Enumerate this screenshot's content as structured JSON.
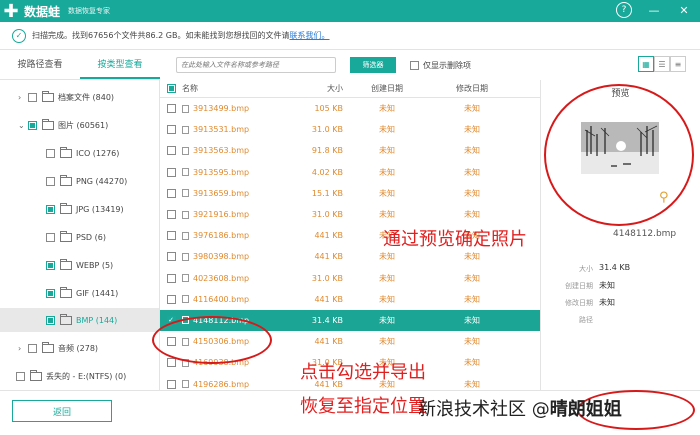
{
  "app": {
    "name": "数据蛙",
    "subtitle": "数据恢复专家",
    "help_icon": "?",
    "minimize": "—",
    "close": "✕",
    "logo_glyph": "✚"
  },
  "status": {
    "text": "扫描完成。找到67656个文件共86.2 GB。如未能找到您想找回的文件请",
    "link": "联系我们。"
  },
  "tabs": [
    "按路径查看",
    "按类型查看"
  ],
  "toolbar": {
    "search_placeholder": "在此处输入文件名称或参考路径",
    "filter_label": "筛选器",
    "deleted_only_label": "仅显示删除项"
  },
  "tree": [
    {
      "label": "档案文件 (840)",
      "caret": "›",
      "level": 0,
      "state": "empty"
    },
    {
      "label": "图片 (60561)",
      "caret": "⌄",
      "level": 0,
      "state": "partial"
    },
    {
      "label": "ICO (1276)",
      "caret": "",
      "level": 1,
      "state": "empty"
    },
    {
      "label": "PNG (44270)",
      "caret": "",
      "level": 1,
      "state": "empty"
    },
    {
      "label": "JPG (13419)",
      "caret": "",
      "level": 1,
      "state": "partial"
    },
    {
      "label": "PSD (6)",
      "caret": "",
      "level": 1,
      "state": "empty"
    },
    {
      "label": "WEBP (5)",
      "caret": "",
      "level": 1,
      "state": "partial"
    },
    {
      "label": "GIF (1441)",
      "caret": "",
      "level": 1,
      "state": "partial"
    },
    {
      "label": "BMP (144)",
      "caret": "",
      "level": 1,
      "state": "partial",
      "selected": true
    },
    {
      "label": "音频 (278)",
      "caret": "›",
      "level": 0,
      "state": "empty"
    },
    {
      "label": "丢失的 - E:(NTFS) (0)",
      "caret": "",
      "level": 0,
      "state": "empty"
    }
  ],
  "table": {
    "headers": {
      "name": "名称",
      "size": "大小",
      "created": "创建日期",
      "modified": "修改日期"
    },
    "rows": [
      {
        "name": "3913499.bmp",
        "size": "105 KB",
        "created": "未知",
        "modified": "未知"
      },
      {
        "name": "3913531.bmp",
        "size": "31.0 KB",
        "created": "未知",
        "modified": "未知"
      },
      {
        "name": "3913563.bmp",
        "size": "91.8 KB",
        "created": "未知",
        "modified": "未知"
      },
      {
        "name": "3913595.bmp",
        "size": "4.02 KB",
        "created": "未知",
        "modified": "未知"
      },
      {
        "name": "3913659.bmp",
        "size": "15.1 KB",
        "created": "未知",
        "modified": "未知"
      },
      {
        "name": "3921916.bmp",
        "size": "31.0 KB",
        "created": "未知",
        "modified": "未知"
      },
      {
        "name": "3976186.bmp",
        "size": "441 KB",
        "created": "未知",
        "modified": "未知"
      },
      {
        "name": "3980398.bmp",
        "size": "441 KB",
        "created": "未知",
        "modified": "未知"
      },
      {
        "name": "4023608.bmp",
        "size": "31.0 KB",
        "created": "未知",
        "modified": "未知"
      },
      {
        "name": "4116400.bmp",
        "size": "441 KB",
        "created": "未知",
        "modified": "未知"
      },
      {
        "name": "4148112.bmp",
        "size": "31.4 KB",
        "created": "未知",
        "modified": "未知",
        "selected": true
      },
      {
        "name": "4150306.bmp",
        "size": "441 KB",
        "created": "未知",
        "modified": "未知"
      },
      {
        "name": "4169938.bmp",
        "size": "31.0 KB",
        "created": "未知",
        "modified": "未知"
      },
      {
        "name": "4196286.bmp",
        "size": "441 KB",
        "created": "未知",
        "modified": "未知"
      }
    ]
  },
  "preview": {
    "title": "预览",
    "file_name": "4148112.bmp",
    "meta": [
      {
        "label": "大小",
        "value": "31.4 KB"
      },
      {
        "label": "创建日期",
        "value": "未知"
      },
      {
        "label": "修改日期",
        "value": "未知"
      },
      {
        "label": "路径",
        "value": ""
      }
    ]
  },
  "footer": {
    "back_label": "返回"
  },
  "annotations": {
    "preview_note": "通过预览确定照片",
    "select_note_1": "点击勾选并导出",
    "select_note_2": "恢复至指定位置",
    "watermark_prefix": "新浪技术社区 @",
    "watermark_name": "晴朗姐姐"
  },
  "colors": {
    "accent": "#18a99a",
    "file_text": "#e08a2e",
    "annotation": "#e02020"
  }
}
